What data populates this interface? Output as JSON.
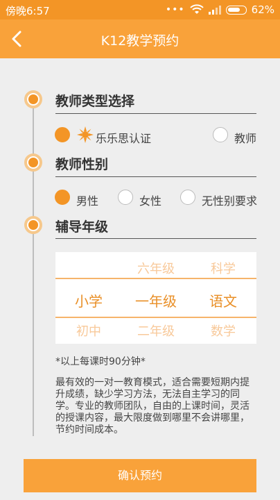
{
  "status": {
    "time": "傍晚6:57",
    "dots": "•••",
    "battery": "62%"
  },
  "header": {
    "title": "K12教学预约"
  },
  "sections": [
    {
      "title": "教师类型选择"
    },
    {
      "title": "教师性别"
    },
    {
      "title": "辅导年级"
    }
  ],
  "teacher_type": {
    "option1": "乐乐思认证",
    "option2": "教师",
    "selected": "乐乐思认证"
  },
  "gender": {
    "option1": "男性",
    "option2": "女性",
    "option3": "无性别要求",
    "selected": "男性"
  },
  "grade_picker": {
    "columns": [
      {
        "above": "",
        "selected": "小学",
        "below": "初中"
      },
      {
        "above": "六年级",
        "selected": "一年级",
        "below": "二年级"
      },
      {
        "above": "科学",
        "selected": "语文",
        "below": "数学"
      }
    ]
  },
  "note": "*以上每课时90分钟*",
  "description": "最有效的一对一教育模式，适合需要短期内提升成绩，缺少学习方法，无法自主学习的同学。专业的教师团队，自由的上课时间，灵活的授课内容，最大限度做到哪里不会讲哪里，节约时间成本。",
  "confirm_button": "确认预约",
  "colors": {
    "accent": "#f9a23a",
    "status_bar": "#f39526"
  }
}
